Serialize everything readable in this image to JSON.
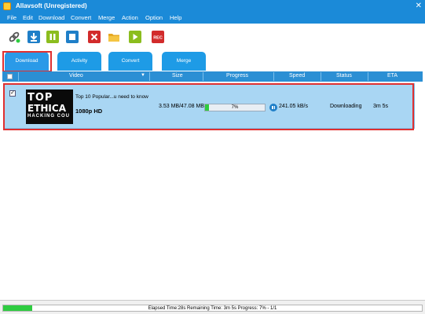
{
  "window": {
    "title": "Allavsoft (Unregistered)",
    "close_glyph": "✕"
  },
  "menu": [
    "File",
    "Edit",
    "Download",
    "Convert",
    "Merge",
    "Action",
    "Option",
    "Help"
  ],
  "toolbar": {
    "buttons": [
      {
        "name": "link-icon",
        "color": "#555555"
      },
      {
        "name": "download-arrow-icon",
        "color": "#1f7fc8"
      },
      {
        "name": "pause-icon",
        "color": "#8bbd1e"
      },
      {
        "name": "stop-icon",
        "color": "#1f7fc8"
      },
      {
        "name": "delete-x-icon",
        "color": "#d22b2b"
      },
      {
        "name": "folder-icon",
        "color": "#e6a821"
      },
      {
        "name": "play-icon",
        "color": "#8bbd1e"
      },
      {
        "name": "record-icon",
        "color": "#d22b2b",
        "label": "REC"
      }
    ]
  },
  "tabs": [
    "Download",
    "Activity",
    "Convert",
    "Merge"
  ],
  "table": {
    "headers": {
      "video": "Video",
      "size": "Size",
      "progress": "Progress",
      "speed": "Speed",
      "status": "Status",
      "eta": "ETA"
    },
    "rows": [
      {
        "checked": "✓",
        "thumb": {
          "line1": "TOP",
          "line2": "ETHICA",
          "line3": "HACKING COU"
        },
        "title": "Top 10 Popular...u need to know",
        "quality": "1080p HD",
        "size": "3.53 MB/47.08 MB",
        "progress_pct": 7,
        "progress_label": "7%",
        "speed": "241.05 kB/s",
        "status": "Downloading",
        "eta": "3m  5s"
      }
    ]
  },
  "statusbar": {
    "progress_pct": 7,
    "text": "Elapsed Time:28s Remaining Time: 3m  5s Progress: 7% - 1/1"
  },
  "colors": {
    "accent": "#1b8ad8",
    "progress_fill": "#2ecc40",
    "highlight": "#e03030",
    "row_selected": "#a9d6f3"
  }
}
